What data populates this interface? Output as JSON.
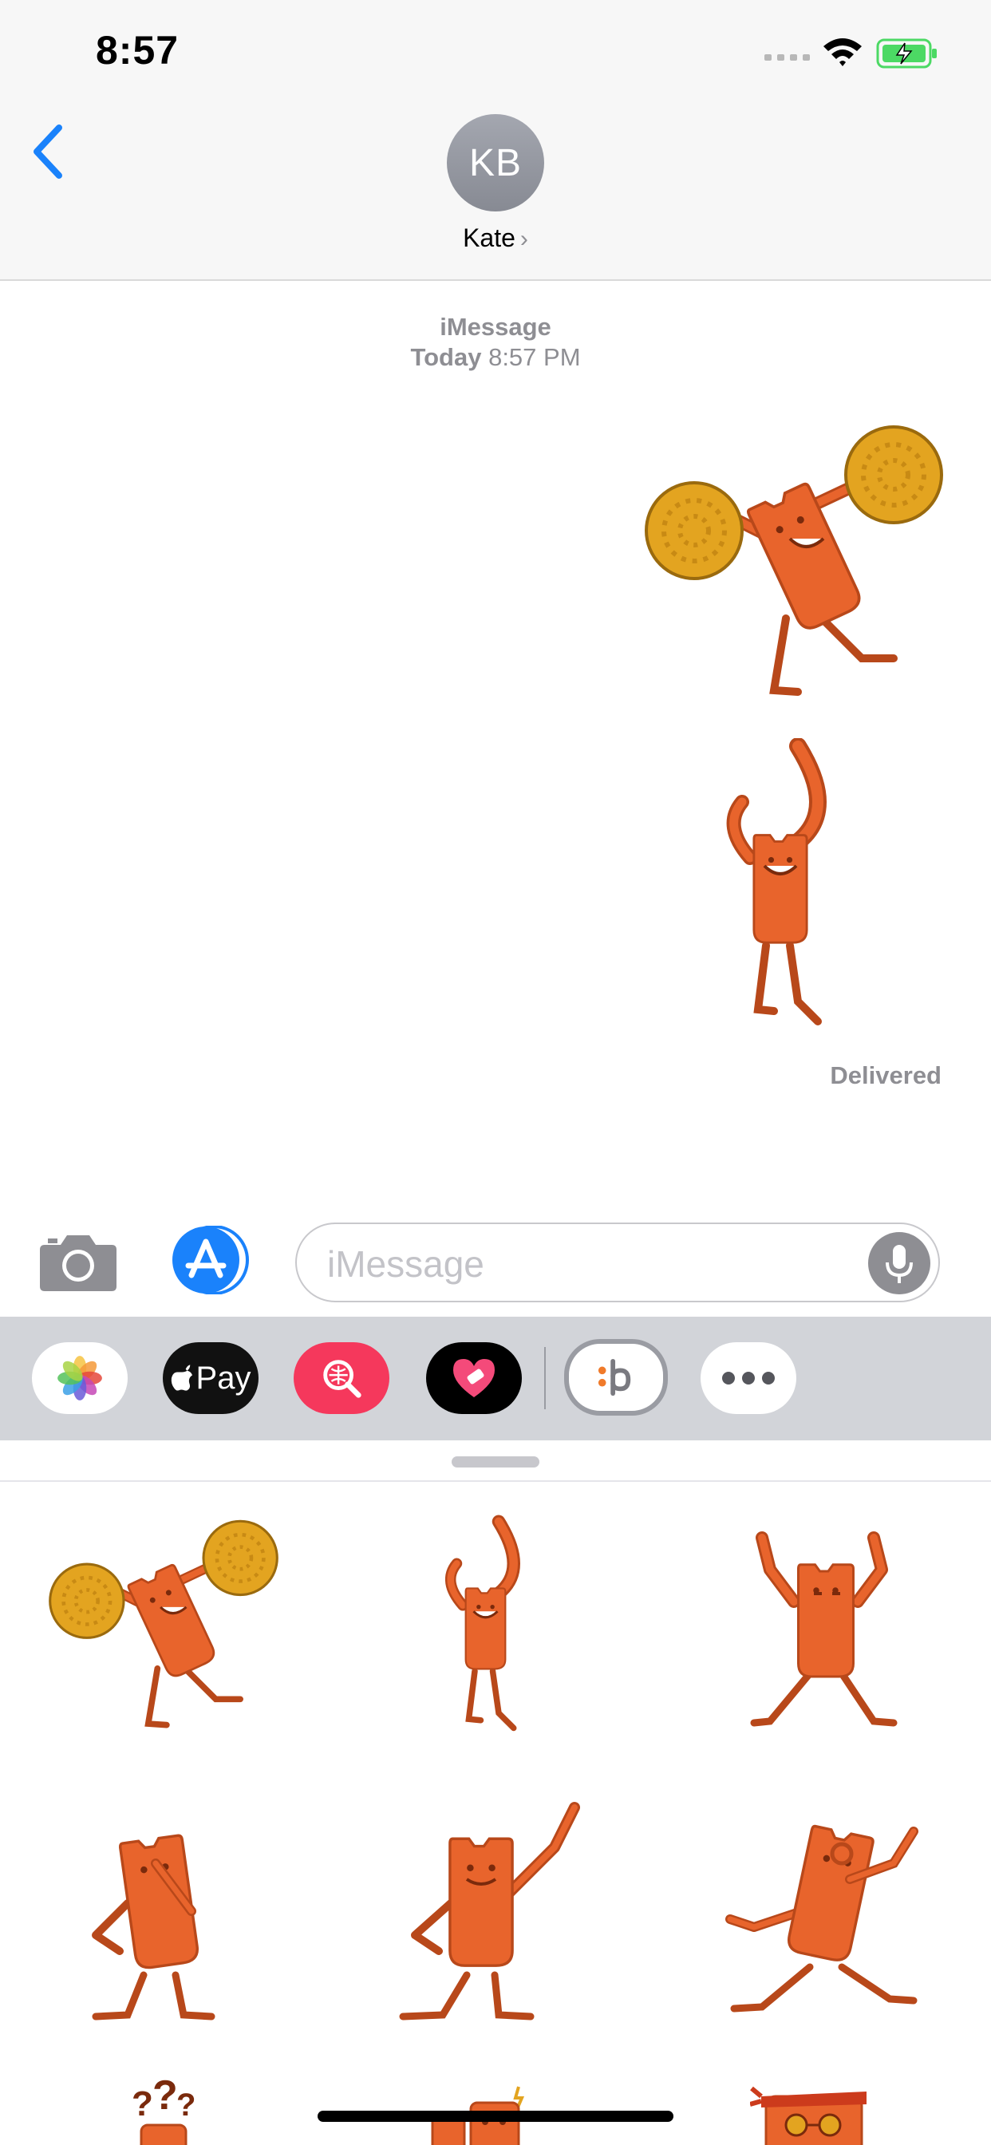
{
  "status_bar": {
    "time": "8:57"
  },
  "header": {
    "avatar_initials": "KB",
    "contact_name": "Kate"
  },
  "conversation": {
    "service": "iMessage",
    "timestamp_day": "Today",
    "timestamp_time": "8:57 PM",
    "delivery_status": "Delivered",
    "messages": [
      {
        "type": "sticker",
        "icon": "cheerleader-pompoms-sticker"
      },
      {
        "type": "sticker",
        "icon": "flexing-arm-sticker"
      }
    ]
  },
  "input": {
    "placeholder": "iMessage"
  },
  "drawer": {
    "apps": [
      {
        "icon": "photos-icon"
      },
      {
        "icon": "apple-pay-icon",
        "label": "Pay"
      },
      {
        "icon": "image-search-icon"
      },
      {
        "icon": "heart-app-icon"
      },
      {
        "icon": "sticker-app-icon",
        "selected": true
      },
      {
        "icon": "more-apps-icon"
      }
    ]
  },
  "sticker_grid": [
    "cheerleader-pompoms-sticker",
    "flexing-arm-sticker",
    "dancing-sticker",
    "thinking-sticker",
    "pointing-up-sticker",
    "ok-hand-sticker",
    "question-mark-sticker",
    "spark-sticker",
    "bandana-sunglasses-sticker"
  ],
  "colors": {
    "accent": "#1a82fb",
    "sticker": "#e8642c",
    "pompom": "#e3a420",
    "battery": "#4cd964"
  }
}
